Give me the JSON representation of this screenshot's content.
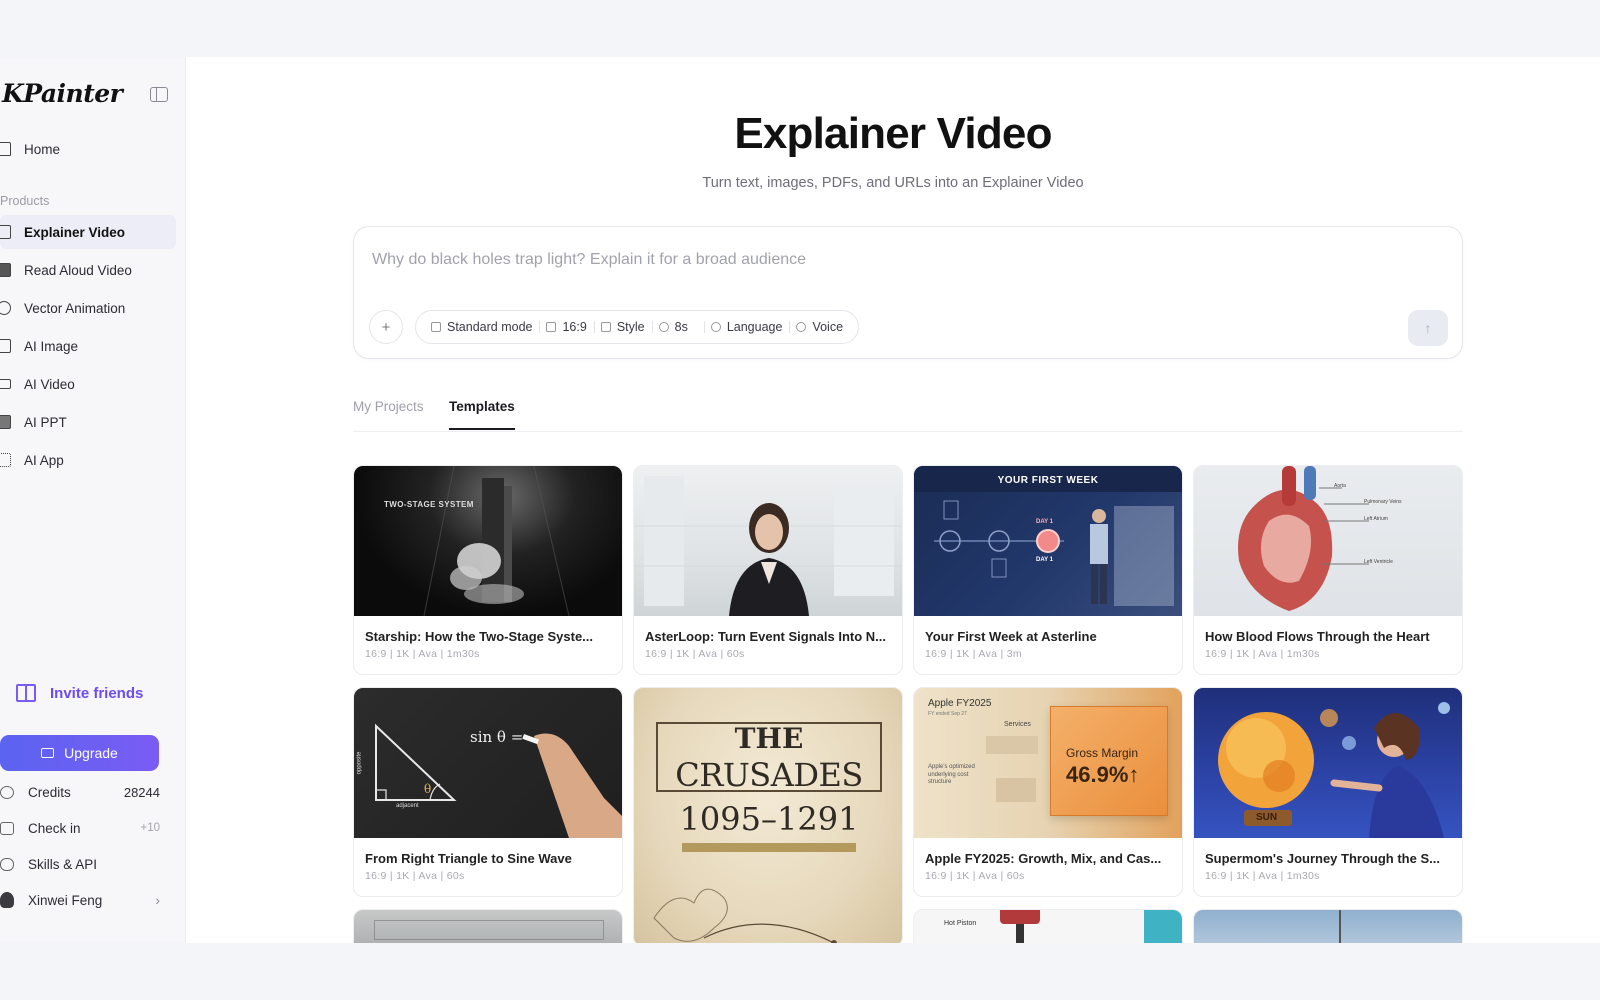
{
  "brand": "KPainter",
  "sidebar": {
    "home": "Home",
    "section_label": "Products",
    "items": [
      {
        "label": "Explainer Video",
        "icon": "play-square-icon",
        "active": true
      },
      {
        "label": "Read Aloud Video",
        "icon": "read-aloud-icon"
      },
      {
        "label": "Vector Animation",
        "icon": "vector-icon"
      },
      {
        "label": "AI Image",
        "icon": "image-icon"
      },
      {
        "label": "AI Video",
        "icon": "video-camera-icon"
      },
      {
        "label": "AI PPT",
        "icon": "slides-icon"
      },
      {
        "label": "AI App",
        "icon": "apps-grid-icon"
      }
    ],
    "invite": "Invite friends",
    "upgrade": "Upgrade",
    "credits_label": "Credits",
    "credits_value": "28244",
    "checkin_label": "Check in",
    "checkin_value": "+10",
    "skills_label": "Skills & API",
    "user_name": "Xinwei Feng"
  },
  "main": {
    "title": "Explainer Video",
    "subtitle": "Turn text, images, PDFs, and URLs into an Explainer Video",
    "prompt_placeholder": "Why do black holes trap light? Explain it for a broad audience",
    "plus": "+",
    "options": {
      "mode": "Standard mode",
      "ratio": "16:9",
      "style": "Style",
      "duration": "8s",
      "language": "Language",
      "voice": "Voice"
    },
    "send": "↑",
    "tabs": [
      "My Projects",
      "Templates"
    ],
    "active_tab": "Templates"
  },
  "templates": [
    {
      "title": "Starship: How the Two-Stage Syste...",
      "meta": "16:9  |  1K  |  Ava  |  1m30s",
      "thumb_text": "TWO-STAGE SYSTEM"
    },
    {
      "title": "AsterLoop: Turn Event Signals Into N...",
      "meta": "16:9  |  1K  |  Ava  |  60s"
    },
    {
      "title": "Your First Week at Asterline",
      "meta": "16:9  |  1K  |  Ava  |  3m",
      "thumb_text": "YOUR FIRST WEEK",
      "day1": "DAY 1"
    },
    {
      "title": "How Blood Flows Through the Heart",
      "meta": "16:9  |  1K  |  Ava  |  1m30s",
      "labels": [
        "Aorta",
        "Pulmonary Veins",
        "Left Atrium",
        "Left Ventricle"
      ]
    },
    {
      "title": "From Right Triangle to Sine Wave",
      "meta": "16:9  |  1K  |  Ava  |  60s",
      "formula": "sin θ =",
      "side_opp": "opposite",
      "side_adj": "adjacent",
      "angle": "θ"
    },
    {
      "title_line1": "THE",
      "title_line2": "CRUSADES",
      "years": "1095–1291"
    },
    {
      "title": "Apple FY2025: Growth, Mix, and Cas...",
      "meta": "16:9  |  1K  |  Ava  |  60s",
      "header": "Apple FY2025",
      "header_sub": "FY ended Sep 27",
      "services": "Services",
      "left_note": "Apple's optimized underlying cost structure",
      "gm_label": "Gross Margin",
      "gm_value": "46.9%↑"
    },
    {
      "title": "Supermom's Journey Through the S...",
      "meta": "16:9  |  1K  |  Ava  |  1m30s",
      "sun_label": "SUN"
    },
    {},
    {
      "label": "Hot Piston"
    },
    {}
  ],
  "colors": {
    "accent": "#6c4cf0",
    "upgrade_start": "#5b63f0",
    "upgrade_end": "#7a5cf4"
  }
}
